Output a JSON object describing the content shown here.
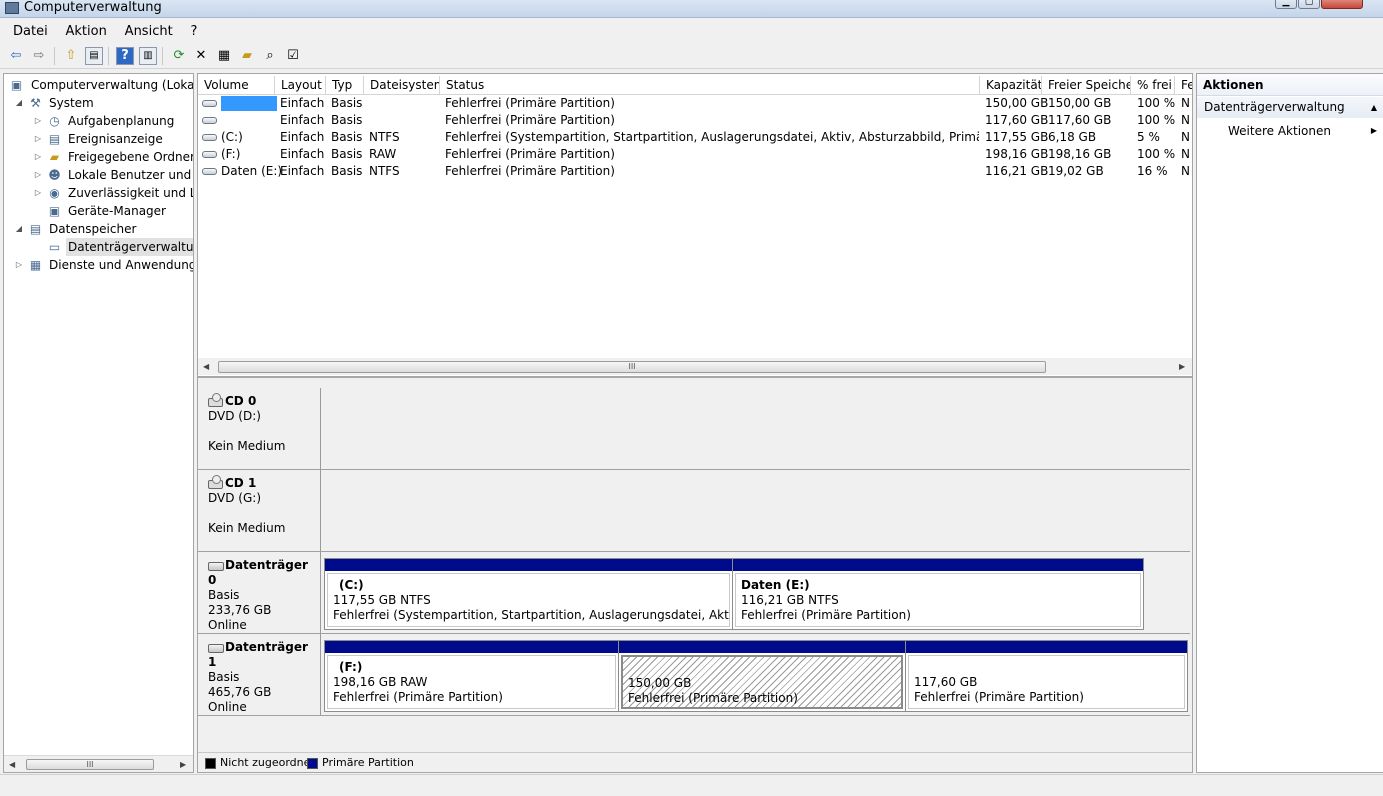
{
  "window": {
    "title": "Computerverwaltung"
  },
  "menu": [
    "Datei",
    "Aktion",
    "Ansicht",
    "?"
  ],
  "tree": {
    "root": "Computerverwaltung (Lokal)",
    "system": "System",
    "system_items": [
      "Aufgabenplanung",
      "Ereignisanzeige",
      "Freigegebene Ordner",
      "Lokale Benutzer und Gruppen",
      "Zuverlässigkeit und Leistung",
      "Geräte-Manager"
    ],
    "storage": "Datenspeicher",
    "storage_items": [
      "Datenträgerverwaltung"
    ],
    "services": "Dienste und Anwendungen"
  },
  "volume_table": {
    "columns": [
      "Volume",
      "Layout",
      "Typ",
      "Dateisystem",
      "Status",
      "Kapazität",
      "Freier Speicher",
      "% frei",
      "Fe"
    ],
    "rows": [
      {
        "volume": "",
        "layout": "Einfach",
        "typ": "Basis",
        "fs": "",
        "status": "Fehlerfrei (Primäre Partition)",
        "cap": "150,00 GB",
        "free": "150,00 GB",
        "pct": "100 %",
        "fe": "N"
      },
      {
        "volume": "",
        "layout": "Einfach",
        "typ": "Basis",
        "fs": "",
        "status": "Fehlerfrei (Primäre Partition)",
        "cap": "117,60 GB",
        "free": "117,60 GB",
        "pct": "100 %",
        "fe": "N"
      },
      {
        "volume": "(C:)",
        "layout": "Einfach",
        "typ": "Basis",
        "fs": "NTFS",
        "status": "Fehlerfrei (Systempartition, Startpartition, Auslagerungsdatei, Aktiv, Absturzabbild, Primäre Partition)",
        "cap": "117,55 GB",
        "free": "6,18 GB",
        "pct": "5 %",
        "fe": "N"
      },
      {
        "volume": "(F:)",
        "layout": "Einfach",
        "typ": "Basis",
        "fs": "RAW",
        "status": "Fehlerfrei (Primäre Partition)",
        "cap": "198,16 GB",
        "free": "198,16 GB",
        "pct": "100 %",
        "fe": "N"
      },
      {
        "volume": "Daten (E:)",
        "layout": "Einfach",
        "typ": "Basis",
        "fs": "NTFS",
        "status": "Fehlerfrei (Primäre Partition)",
        "cap": "116,21 GB",
        "free": "19,02 GB",
        "pct": "16 %",
        "fe": "N"
      }
    ],
    "scroll_glyph": "III"
  },
  "disks": [
    {
      "name": "CD 0",
      "line1": "DVD (D:)",
      "line3": "Kein Medium"
    },
    {
      "name": "CD 1",
      "line1": "DVD (G:)",
      "line3": "Kein Medium"
    },
    {
      "name": "Datenträger 0",
      "line1": "Basis",
      "line2": "233,76 GB",
      "line3": "Online",
      "partitions": [
        {
          "label": "(C:)",
          "size": "117,55 GB NTFS",
          "status": "Fehlerfrei (Systempartition, Startpartition, Auslagerungsdatei, Aktiv, Absturzabbild, Primäre Partition)"
        },
        {
          "label": "Daten  (E:)",
          "size": "116,21 GB NTFS",
          "status": "Fehlerfrei (Primäre Partition)"
        }
      ]
    },
    {
      "name": "Datenträger 1",
      "line1": "Basis",
      "line2": "465,76 GB",
      "line3": "Online",
      "partitions": [
        {
          "label": "(F:)",
          "size": "198,16 GB RAW",
          "status": "Fehlerfrei (Primäre Partition)"
        },
        {
          "label": "",
          "size": "150,00 GB",
          "status": "Fehlerfrei (Primäre Partition)"
        },
        {
          "label": "",
          "size": "117,60 GB",
          "status": "Fehlerfrei (Primäre Partition)"
        }
      ]
    }
  ],
  "legend": {
    "unallocated": "Nicht zugeordnet",
    "primary": "Primäre Partition"
  },
  "actions": {
    "title": "Aktionen",
    "section": "Datenträgerverwaltung",
    "more": "Weitere Aktionen"
  },
  "colors": {
    "primary_partition": "#000b8c",
    "unallocated": "#000000",
    "selection": "#3399ff"
  }
}
